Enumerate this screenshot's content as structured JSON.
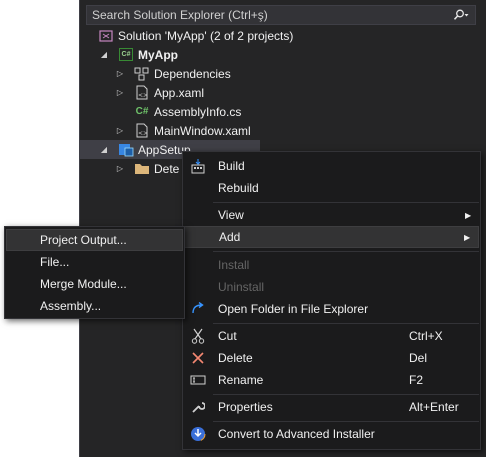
{
  "search": {
    "placeholder": "Search Solution Explorer (Ctrl+ş)"
  },
  "tree": {
    "solution": "Solution 'MyApp' (2 of 2 projects)",
    "project1": "MyApp",
    "project1_badge": "C#",
    "dependencies": "Dependencies",
    "app_xaml": "App.xaml",
    "assemblyinfo": "AssemblyInfo.cs",
    "assemblyinfo_badge": "C#",
    "mainwindow": "MainWindow.xaml",
    "project2": "AppSetup",
    "detected": "Dete"
  },
  "context_menu": {
    "build": "Build",
    "rebuild": "Rebuild",
    "view": "View",
    "add": "Add",
    "install": "Install",
    "uninstall": "Uninstall",
    "open_folder": "Open Folder in File Explorer",
    "cut": "Cut",
    "cut_key": "Ctrl+X",
    "delete": "Delete",
    "delete_key": "Del",
    "rename": "Rename",
    "rename_key": "F2",
    "properties": "Properties",
    "properties_key": "Alt+Enter",
    "convert": "Convert to Advanced Installer"
  },
  "add_submenu": {
    "project_output": "Project Output...",
    "file": "File...",
    "merge_module": "Merge Module...",
    "assembly": "Assembly..."
  },
  "colors": {
    "panel_bg": "#252526",
    "menu_bg": "#1b1b1c",
    "csharp_green": "#388a34",
    "delete_red": "#f48771",
    "accent_blue": "#3794ff"
  }
}
